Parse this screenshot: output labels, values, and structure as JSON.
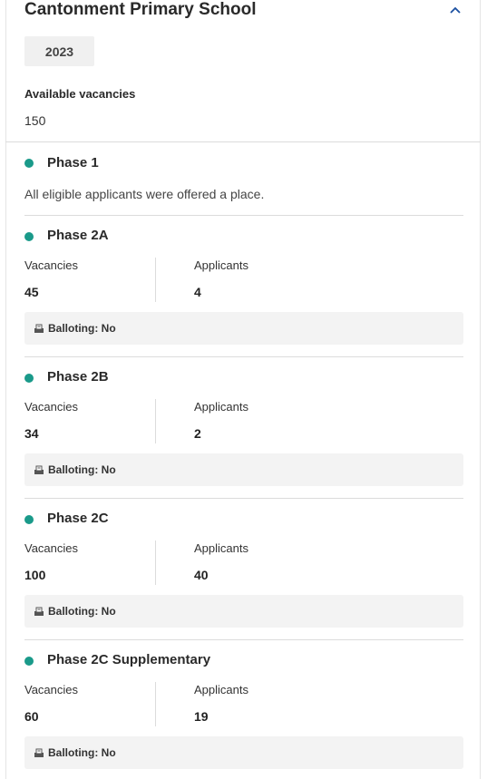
{
  "school": {
    "name": "Cantonment Primary School",
    "year": "2023"
  },
  "available": {
    "label": "Available vacancies",
    "value": "150"
  },
  "phase1": {
    "title": "Phase 1",
    "note": "All eligible applicants were offered a place."
  },
  "labels": {
    "vacancies": "Vacancies",
    "applicants": "Applicants"
  },
  "phases": [
    {
      "title": "Phase 2A",
      "vacancies": "45",
      "applicants": "4",
      "balloting": "Balloting: No"
    },
    {
      "title": "Phase 2B",
      "vacancies": "34",
      "applicants": "2",
      "balloting": "Balloting: No"
    },
    {
      "title": "Phase 2C",
      "vacancies": "100",
      "applicants": "40",
      "balloting": "Balloting: No"
    },
    {
      "title": "Phase 2C Supplementary",
      "vacancies": "60",
      "applicants": "19",
      "balloting": "Balloting: No"
    }
  ],
  "colors": {
    "accent": "#1a9a8a"
  }
}
